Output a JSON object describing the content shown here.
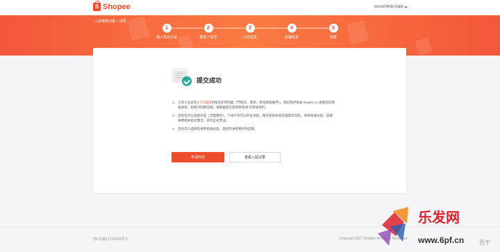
{
  "header": {
    "brand": "Shopee",
    "logo_glyph": "S",
    "user": "xxxxx04sb:main"
  },
  "banner": {
    "breadcrumb": "入驻审核记录 > 详情",
    "steps": [
      {
        "number": "1",
        "label": "填入实名认证"
      },
      {
        "number": "2",
        "label": "联系人信息"
      },
      {
        "number": "3",
        "label": "公司信息"
      },
      {
        "number": "4",
        "label": "店铺信息"
      },
      {
        "number": "5",
        "label": "完成"
      }
    ]
  },
  "result": {
    "title": "提交成功",
    "notes": [
      {
        "num": "1.",
        "pre": "工作人员会在",
        "highlight": "5个工作日",
        "post": "内给您初审回复（节假日、周末、暂化刺能顺序），请您及时登录 shopee.cn 查看您的审核进度，如果对判断回来，请根据提示及时修改/补交审核材料。"
      },
      {
        "num": "2.",
        "text": "您现在可以选择开店（无需费权），个体户仅可以开台湾店，用于提前体验店铺操作流程，待审核通过后，店铺将费权并启动激活，即可正式营业。"
      },
      {
        "num": "3.",
        "text": "您也可以选择等待审核通过后，直接开通有费权的店铺。"
      }
    ]
  },
  "actions": {
    "primary": "申请开店",
    "secondary": "查看入驻记录"
  },
  "footer": {
    "icp": "粤ICP备17135694号-2",
    "copyright": "Copyright 2021 Shopee All Rights Reserved"
  },
  "watermark": {
    "brand": "乐发网",
    "site": "www.6pf.cn",
    "glyphs": "百干",
    "colors": [
      "#d9232e",
      "#f08a1c",
      "#2a5db0",
      "#8a3fb5"
    ]
  },
  "colors": {
    "brand": "#ee4d2d",
    "success": "#26aa99"
  }
}
